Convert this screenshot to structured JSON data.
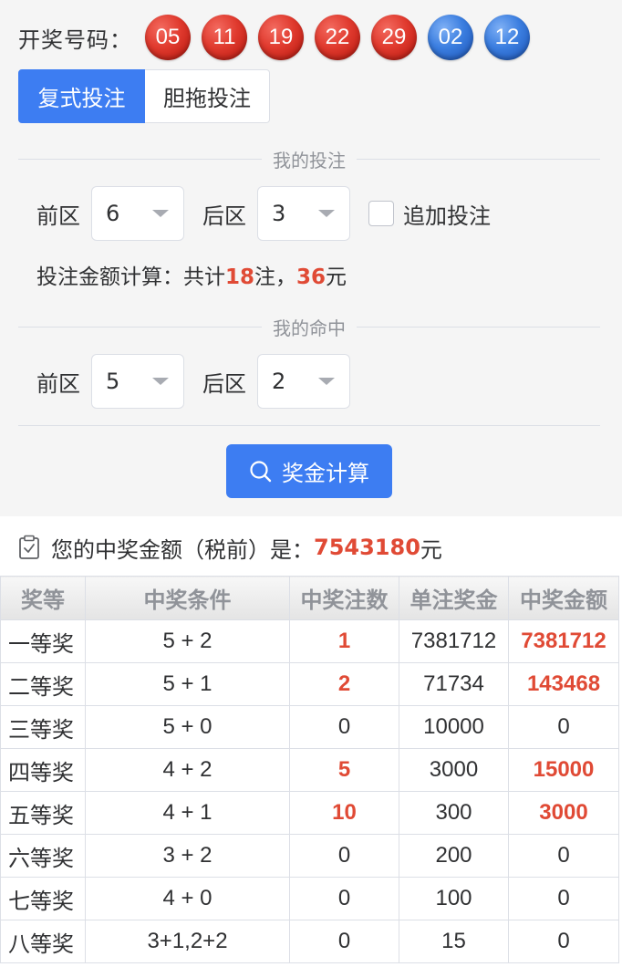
{
  "draw": {
    "label": "开奖号码：",
    "front_balls": [
      "05",
      "11",
      "19",
      "22",
      "29"
    ],
    "back_balls": [
      "02",
      "12"
    ],
    "colors": {
      "red": "#e03a2e",
      "blue": "#3b7ee0"
    }
  },
  "mode_tabs": [
    {
      "label": "复式投注",
      "active": true
    },
    {
      "label": "胆拖投注",
      "active": false
    }
  ],
  "bet_section": {
    "divider": "我的投注",
    "front_label": "前区",
    "front_value": "6",
    "back_label": "后区",
    "back_value": "3",
    "additional_label": "追加投注",
    "additional_checked": false,
    "cost_prefix": "投注金额计算：共计",
    "cost_bets": "18",
    "cost_mid": "注，",
    "cost_amount": "36",
    "cost_unit": "元"
  },
  "hit_section": {
    "divider": "我的命中",
    "front_label": "前区",
    "front_value": "5",
    "back_label": "后区",
    "back_value": "2"
  },
  "calc_button": {
    "label": "奖金计算",
    "icon": "search-icon"
  },
  "result": {
    "icon": "clipboard-check-icon",
    "prefix": "您的中奖金额（税前）是：",
    "amount": "7543180",
    "unit": "元"
  },
  "table": {
    "headers": [
      "奖等",
      "中奖条件",
      "中奖注数",
      "单注奖金",
      "中奖金额"
    ],
    "rows": [
      {
        "level": "一等奖",
        "condition": "5 + 2",
        "count": "1",
        "unit_prize": "7381712",
        "total": "7381712",
        "win": true
      },
      {
        "level": "二等奖",
        "condition": "5 + 1",
        "count": "2",
        "unit_prize": "71734",
        "total": "143468",
        "win": true
      },
      {
        "level": "三等奖",
        "condition": "5 + 0",
        "count": "0",
        "unit_prize": "10000",
        "total": "0",
        "win": false
      },
      {
        "level": "四等奖",
        "condition": "4 + 2",
        "count": "5",
        "unit_prize": "3000",
        "total": "15000",
        "win": true
      },
      {
        "level": "五等奖",
        "condition": "4 + 1",
        "count": "10",
        "unit_prize": "300",
        "total": "3000",
        "win": true
      },
      {
        "level": "六等奖",
        "condition": "3 + 2",
        "count": "0",
        "unit_prize": "200",
        "total": "0",
        "win": false
      },
      {
        "level": "七等奖",
        "condition": "4 + 0",
        "count": "0",
        "unit_prize": "100",
        "total": "0",
        "win": false
      },
      {
        "level": "八等奖",
        "condition": "3+1,2+2",
        "count": "0",
        "unit_prize": "15",
        "total": "0",
        "win": false
      }
    ]
  }
}
